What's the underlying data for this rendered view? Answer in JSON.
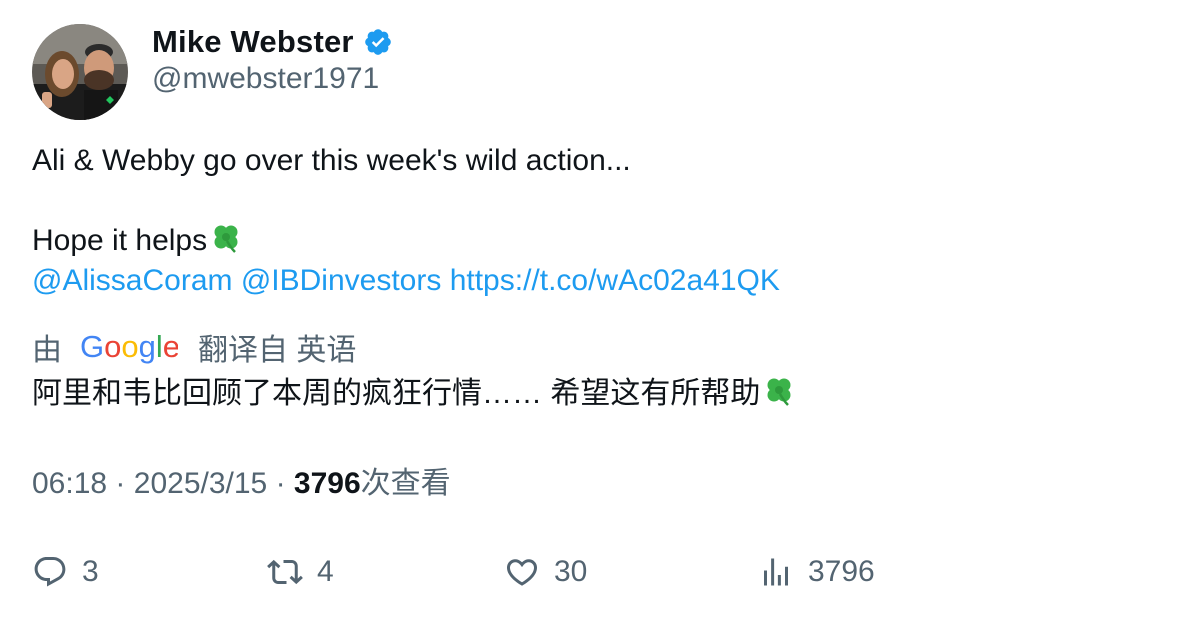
{
  "author": {
    "display_name": "Mike Webster",
    "handle": "@mwebster1971"
  },
  "tweet": {
    "line1": "Ali & Webby go over this week's wild action...",
    "line2": "Hope it helps",
    "mention1": "@AlissaCoram",
    "mention2": "@IBDinvestors",
    "link": "https://t.co/wAc02a41QK"
  },
  "translation": {
    "prefix": "由",
    "provider": "Google",
    "suffix": "翻译自 英语",
    "text": "阿里和韦比回顾了本周的疯狂行情…… 希望这有所帮助"
  },
  "meta": {
    "time": "06:18",
    "date": "2025/3/15",
    "views": "3796",
    "views_label": "次查看",
    "separator": "·"
  },
  "actions": {
    "replies": "3",
    "retweets": "4",
    "likes": "30",
    "views": "3796"
  },
  "colors": {
    "accent": "#1d9bf0",
    "secondary_text": "#536471",
    "primary_text": "#0f1419"
  }
}
